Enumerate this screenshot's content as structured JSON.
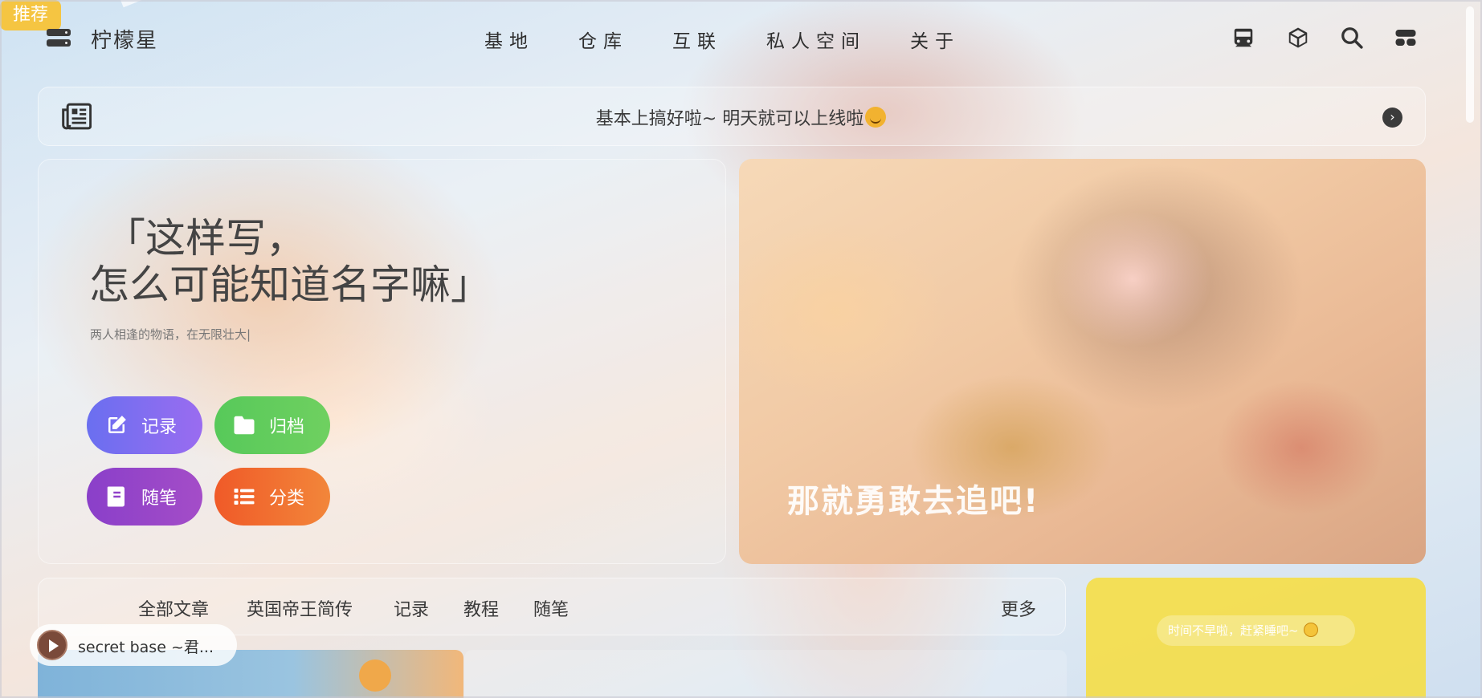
{
  "header": {
    "site_title": "柠檬星",
    "nav": [
      "基地",
      "仓库",
      "互联",
      "私人空间",
      "关于"
    ]
  },
  "notice": {
    "text": "基本上搞好啦~ 明天就可以上线啦"
  },
  "hero": {
    "quote_line1": "「这样写，",
    "quote_line2": "怎么可能知道名字嘛」",
    "subtitle": "两人相逢的物语，在无限壮大|",
    "buttons": {
      "record": "记录",
      "archive": "归档",
      "essay": "随笔",
      "category": "分类"
    },
    "banner_text": "那就勇敢去追吧!"
  },
  "tabs": {
    "active": "推荐",
    "items": [
      "全部文章",
      "英国帝王简传",
      "记录",
      "教程",
      "随笔"
    ],
    "more": "更多"
  },
  "widget": {
    "text": "时间不早啦，赶紧睡吧~"
  },
  "player": {
    "title": "secret base ~君..."
  },
  "colors": {
    "record": "#6a6ff0",
    "archive": "#57c95a",
    "essay": "#8a3fc9",
    "category": "#f05a28",
    "tab_active": "#f5c542",
    "widget": "#f7dd3c"
  }
}
